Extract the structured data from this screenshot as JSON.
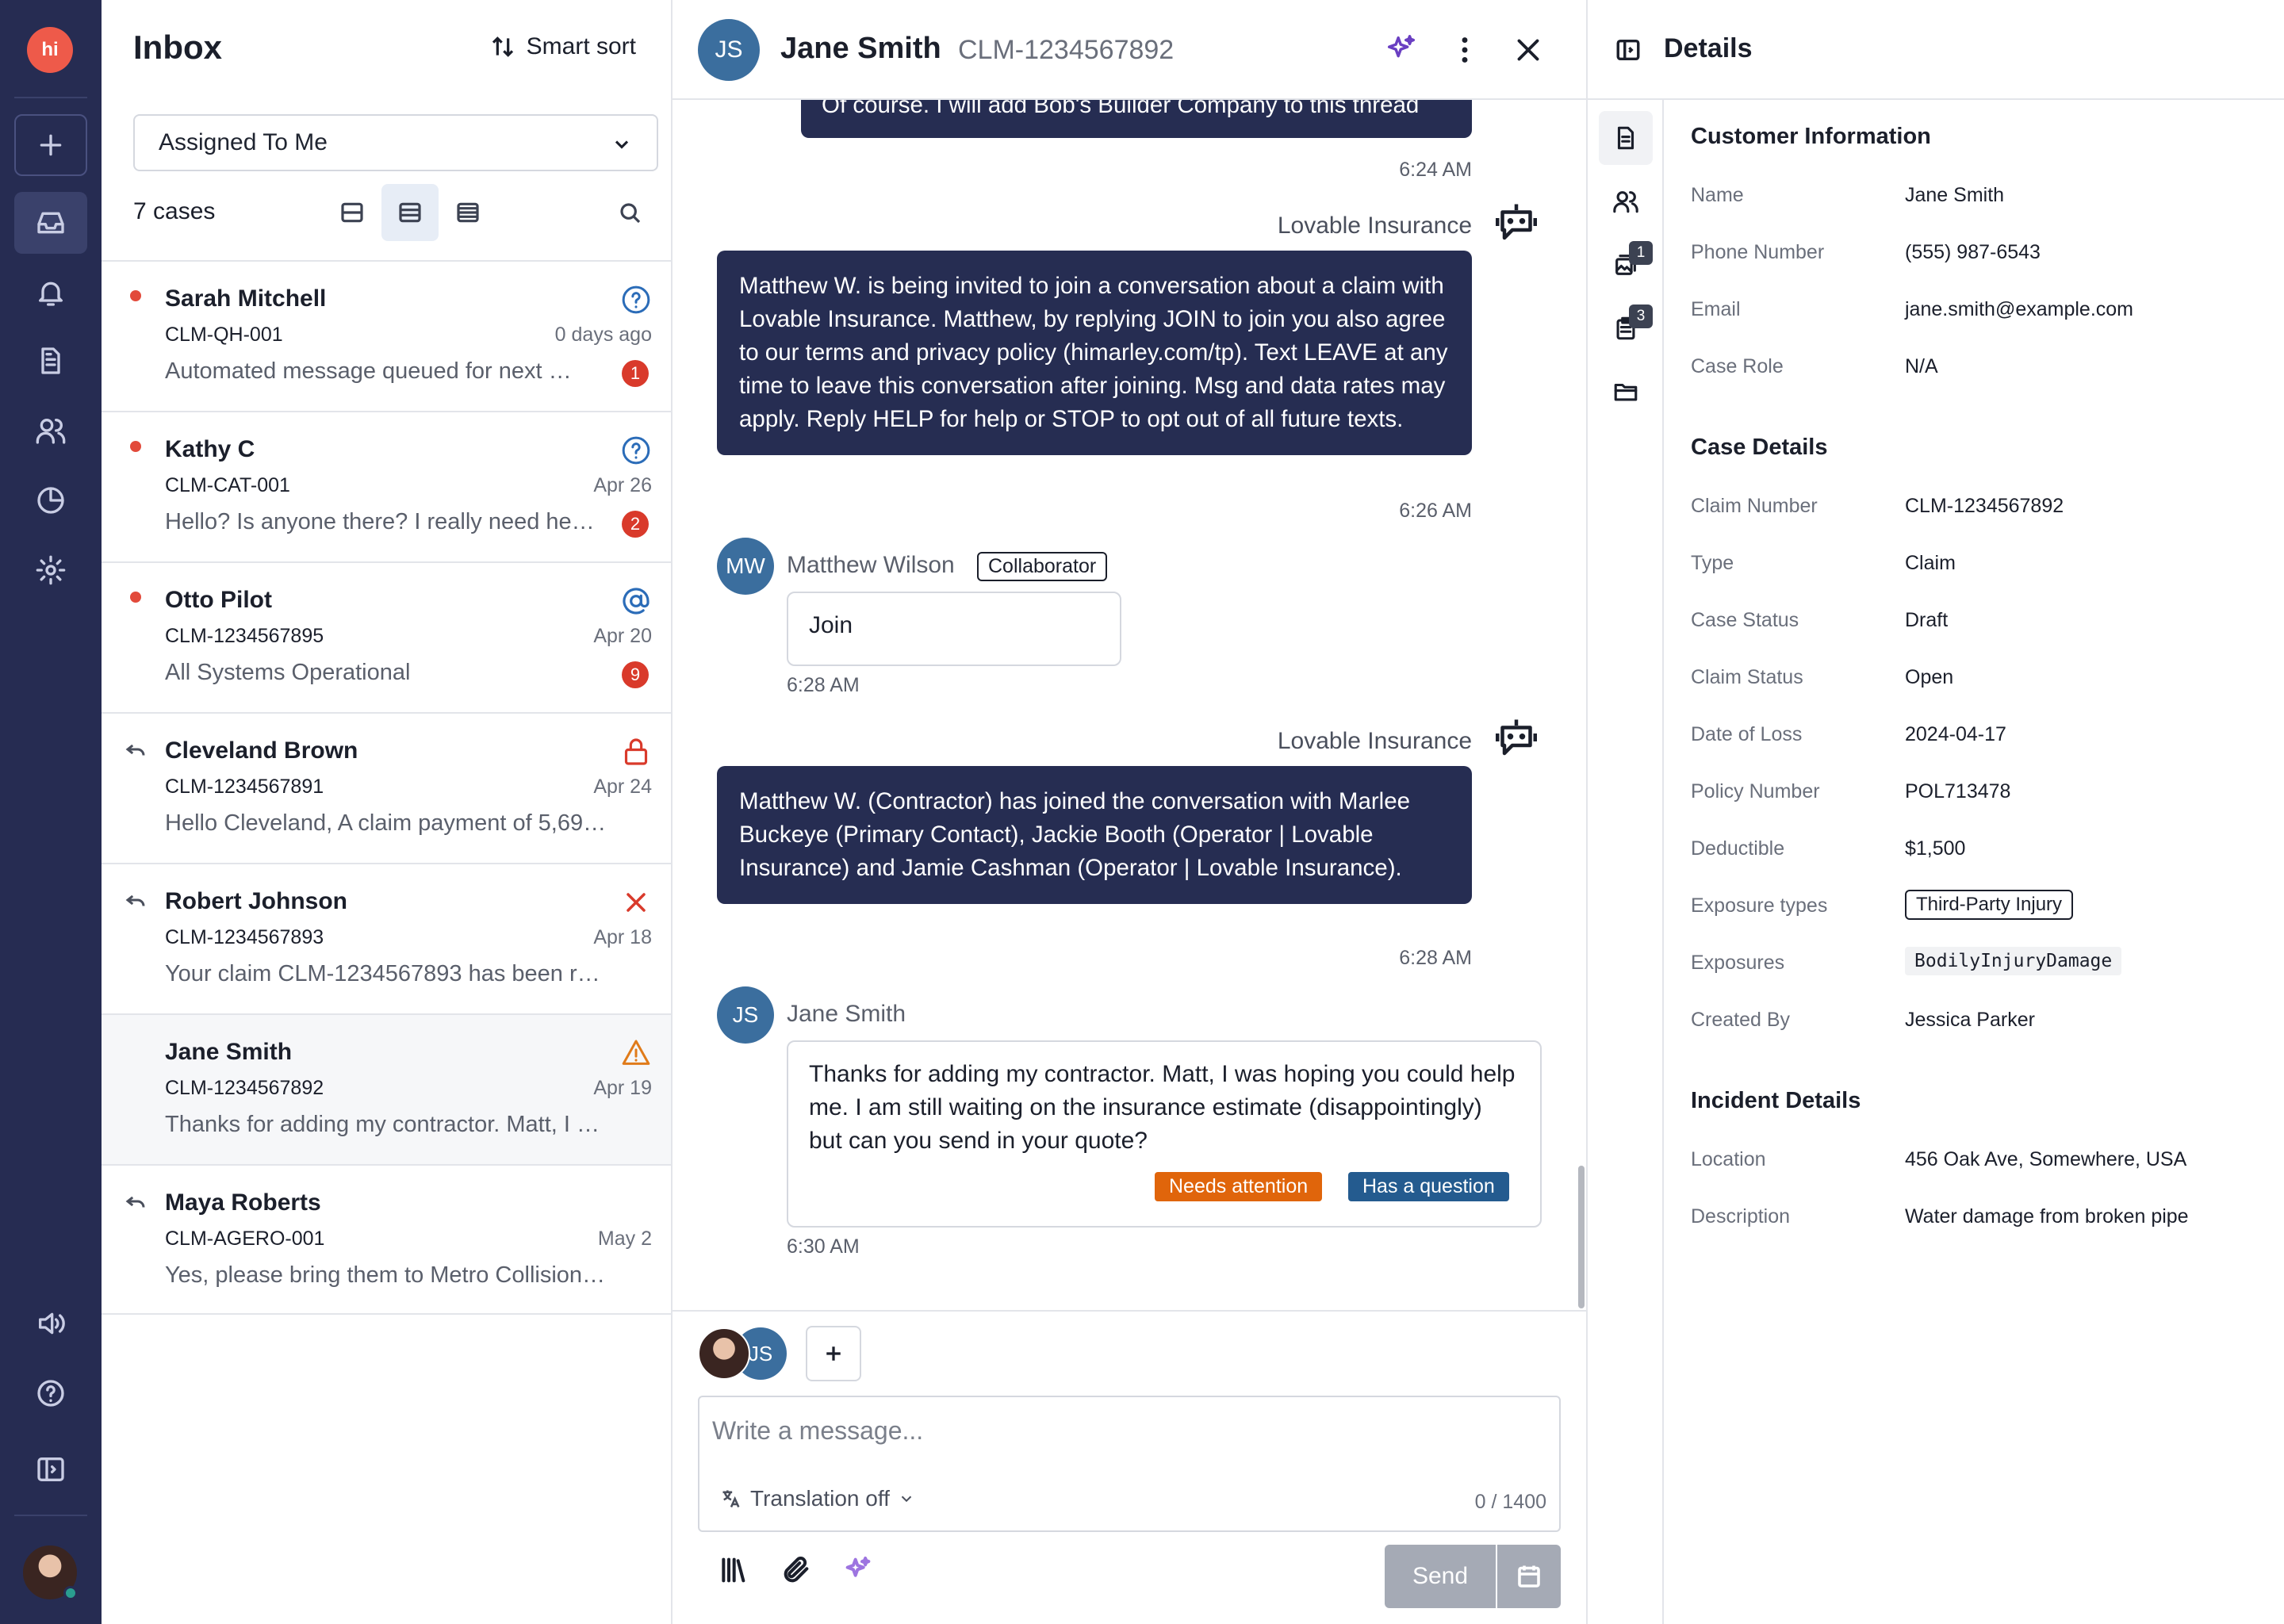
{
  "app": {
    "logo_text": "hi"
  },
  "inbox": {
    "title": "Inbox",
    "smart_sort_label": "Smart sort",
    "filter_value": "Assigned To Me",
    "case_count": "7 cases",
    "rows": [
      {
        "name": "Sarah Mitchell",
        "claim": "CLM-QH-001",
        "date": "0 days ago",
        "preview": "Automated message queued for next …",
        "badge": "1",
        "status_icon": "question-icon",
        "unread": true,
        "replied": false
      },
      {
        "name": "Kathy C",
        "claim": "CLM-CAT-001",
        "date": "Apr 26",
        "preview": "Hello? Is anyone there? I really need he…",
        "badge": "2",
        "status_icon": "question-icon",
        "unread": true,
        "replied": false
      },
      {
        "name": "Otto Pilot",
        "claim": "CLM-1234567895",
        "date": "Apr 20",
        "preview": "All Systems Operational",
        "badge": "9",
        "status_icon": "at-sign-icon",
        "unread": true,
        "replied": false
      },
      {
        "name": "Cleveland Brown",
        "claim": "CLM-1234567891",
        "date": "Apr 24",
        "preview": "Hello Cleveland, A claim payment of 5,69…",
        "badge": "",
        "status_icon": "lock-icon",
        "unread": false,
        "replied": true
      },
      {
        "name": "Robert Johnson",
        "claim": "CLM-1234567893",
        "date": "Apr 18",
        "preview": "Your claim CLM-1234567893 has been rec…",
        "badge": "",
        "status_icon": "x-icon",
        "unread": false,
        "replied": true
      },
      {
        "name": "Jane Smith",
        "claim": "CLM-1234567892",
        "date": "Apr 19",
        "preview": "Thanks for adding my contractor. Matt, I …",
        "badge": "",
        "status_icon": "warning-icon",
        "unread": false,
        "replied": false
      },
      {
        "name": "Maya Roberts",
        "claim": "CLM-AGERO-001",
        "date": "May 2",
        "preview": "Yes, please bring them to Metro Collision …",
        "badge": "",
        "status_icon": "",
        "unread": false,
        "replied": true
      }
    ]
  },
  "conversation": {
    "avatar_initials": "JS",
    "name": "Jane Smith",
    "claim": "CLM-1234567892",
    "messages": {
      "m1_text": "Of course. I will add Bob's Builder Company to this thread",
      "m1_time": "6:24 AM",
      "m2_sender": "Lovable Insurance",
      "m2_text": "Matthew W. is being invited to join a conversation about a claim with Lovable Insurance. Matthew, by replying JOIN to join you also agree to our terms and privacy policy (himarley.com/tp). Text LEAVE at any time to leave this conversation after joining. Msg and data rates may apply. Reply HELP for help or STOP to opt out of all future texts.",
      "m2_time": "6:26 AM",
      "m3_initials": "MW",
      "m3_sender": "Matthew Wilson",
      "m3_role": "Collaborator",
      "m3_text": "Join",
      "m3_time": "6:28 AM",
      "m4_sender": "Lovable Insurance",
      "m4_text": "Matthew W. (Contractor) has joined the conversation with Marlee Buckeye (Primary Contact), Jackie Booth (Operator | Lovable Insurance) and Jamie Cashman (Operator | Lovable Insurance).",
      "m4_time": "6:28 AM",
      "m5_initials": "JS",
      "m5_sender": "Jane Smith",
      "m5_text": "Thanks for adding my contractor. Matt, I was hoping you could help me. I am still waiting on the insurance estimate (disappointingly) but can you send in your quote?",
      "m5_tag1": "Needs attention",
      "m5_tag2": "Has a question",
      "m5_time": "6:30 AM"
    },
    "composer": {
      "participant_initials": "JS",
      "placeholder": "Write a message...",
      "translation": "Translation off",
      "counter": "0 / 1400",
      "send_label": "Send"
    }
  },
  "details": {
    "title": "Details",
    "tab_badges": {
      "images": "1",
      "notes": "3"
    },
    "customer": {
      "title": "Customer Information",
      "fields": [
        {
          "label": "Name",
          "value": "Jane Smith"
        },
        {
          "label": "Phone Number",
          "value": "(555) 987-6543"
        },
        {
          "label": "Email",
          "value": "jane.smith@example.com"
        },
        {
          "label": "Case Role",
          "value": "N/A"
        }
      ]
    },
    "case": {
      "title": "Case Details",
      "fields": [
        {
          "label": "Claim Number",
          "value": "CLM-1234567892"
        },
        {
          "label": "Type",
          "value": "Claim"
        },
        {
          "label": "Case Status",
          "value": "Draft"
        },
        {
          "label": "Claim Status",
          "value": "Open"
        },
        {
          "label": "Date of Loss",
          "value": "2024-04-17"
        },
        {
          "label": "Policy Number",
          "value": "POL713478"
        },
        {
          "label": "Deductible",
          "value": "$1,500"
        },
        {
          "label": "Exposure types",
          "value": "Third-Party Injury"
        },
        {
          "label": "Exposures",
          "value": "BodilyInjuryDamage"
        },
        {
          "label": "Created By",
          "value": "Jessica Parker"
        }
      ]
    },
    "incident": {
      "title": "Incident Details",
      "fields": [
        {
          "label": "Location",
          "value": "456 Oak Ave, Somewhere, USA"
        },
        {
          "label": "Description",
          "value": "Water damage from broken pipe"
        }
      ]
    }
  },
  "colors": {
    "rail": "#262c52",
    "bubble_outgoing": "#262d52",
    "needs_attention": "#e0650b",
    "has_question": "#245b8f",
    "unread_dot": "#e24a3b",
    "badge": "#d93a2b"
  }
}
